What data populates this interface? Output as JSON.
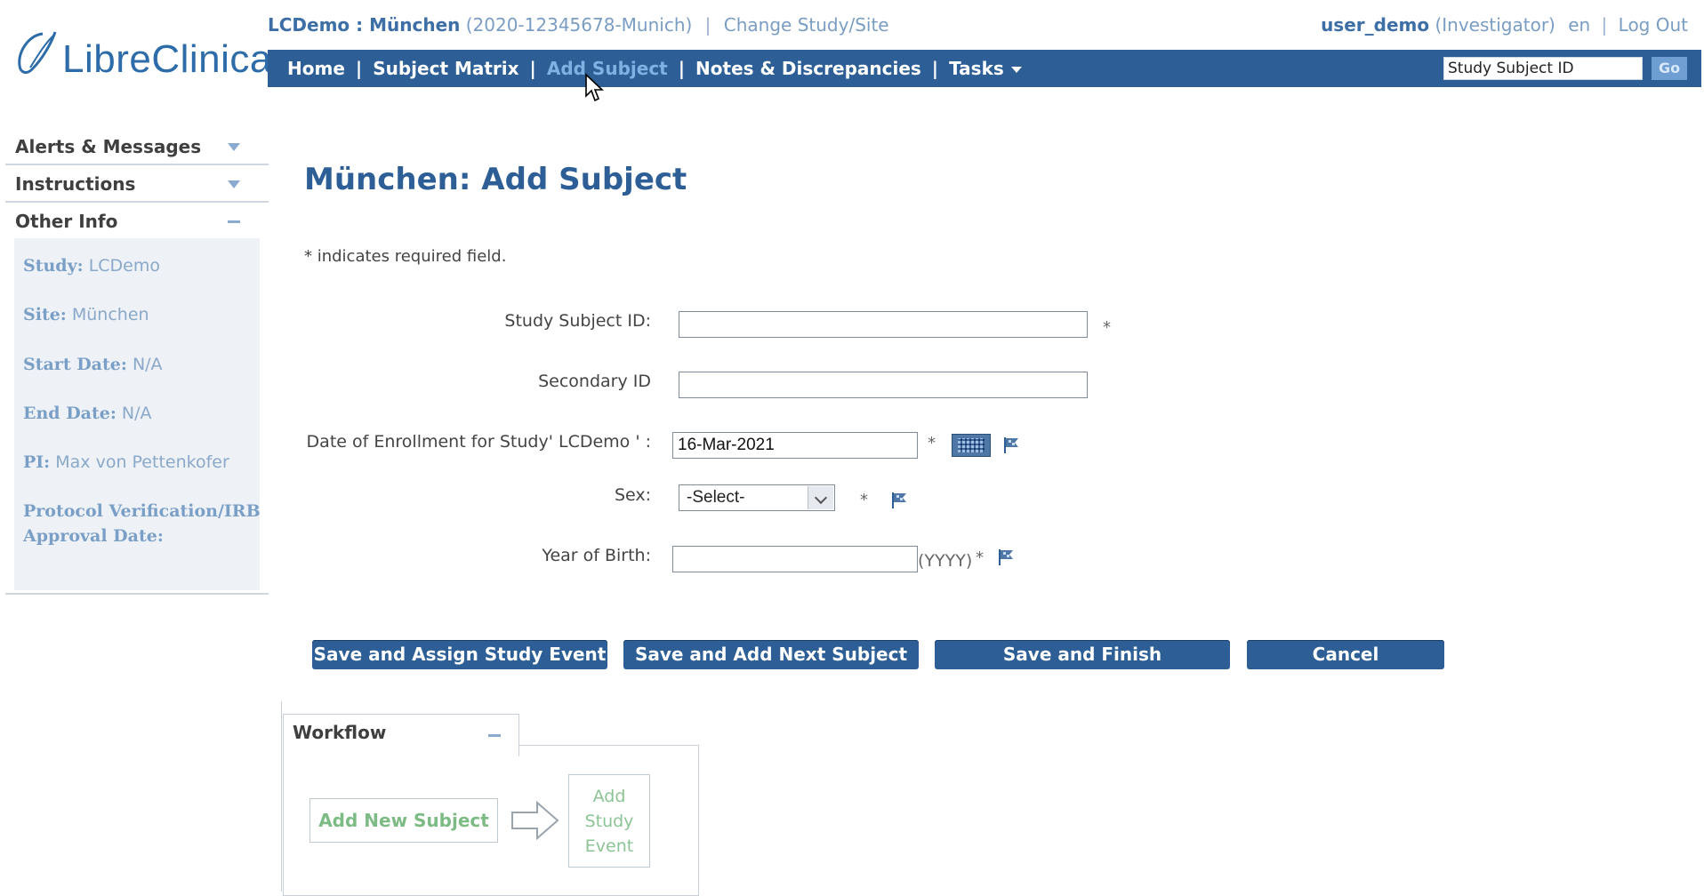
{
  "header": {
    "logo_text": "LibreClinica",
    "study_name": "LCDemo : München",
    "study_code": "(2020-12345678-Munich)",
    "change_link": "Change Study/Site",
    "user_name": "user_demo",
    "user_role": "(Investigator)",
    "language": "en",
    "logout": "Log Out"
  },
  "nav": {
    "items": [
      "Home",
      "Subject Matrix",
      "Add Subject",
      "Notes & Discrepancies",
      "Tasks"
    ],
    "active": "Add Subject",
    "search_value": "Study Subject ID",
    "go_label": "Go"
  },
  "sidebar": {
    "sections": [
      "Alerts & Messages",
      "Instructions",
      "Other Info"
    ],
    "info": [
      {
        "label": "Study:",
        "value": "LCDemo"
      },
      {
        "label": "Site:",
        "value": "München"
      },
      {
        "label": "Start Date:",
        "value": "N/A"
      },
      {
        "label": "End Date:",
        "value": "N/A"
      },
      {
        "label": "PI:",
        "value": "Max von Pettenkofer"
      },
      {
        "label": "Protocol Verification/IRB",
        "value": ""
      },
      {
        "label": "Approval Date:",
        "value": ""
      }
    ]
  },
  "main": {
    "title": "München: Add Subject",
    "required_note": "* indicates required field.",
    "fields": {
      "subject_id_label": "Study Subject ID:",
      "subject_id_value": "",
      "secondary_id_label": "Secondary ID",
      "secondary_id_value": "",
      "enrollment_label": "Date of Enrollment for Study' LCDemo ' :",
      "enrollment_value": "16-Mar-2021",
      "sex_label": "Sex:",
      "sex_value": "-Select-",
      "yob_label": "Year of Birth:",
      "yob_value": "",
      "yob_hint": "(YYYY)",
      "required_mark": "*"
    },
    "buttons": {
      "assign_event": "Save and Assign Study Event",
      "add_next": "Save and Add Next Subject",
      "finish": "Save and Finish",
      "cancel": "Cancel"
    }
  },
  "workflow": {
    "title": "Workflow",
    "step1": "Add New Subject",
    "step2_line1": "Add",
    "step2_line2": "Study",
    "step2_line3": "Event"
  },
  "colors": {
    "nav_bg": "#2d5f96",
    "title": "#2d5f96",
    "link": "#7a9dc4",
    "active_nav": "#7fb2e3",
    "workflow_green": "#7dbb85"
  }
}
